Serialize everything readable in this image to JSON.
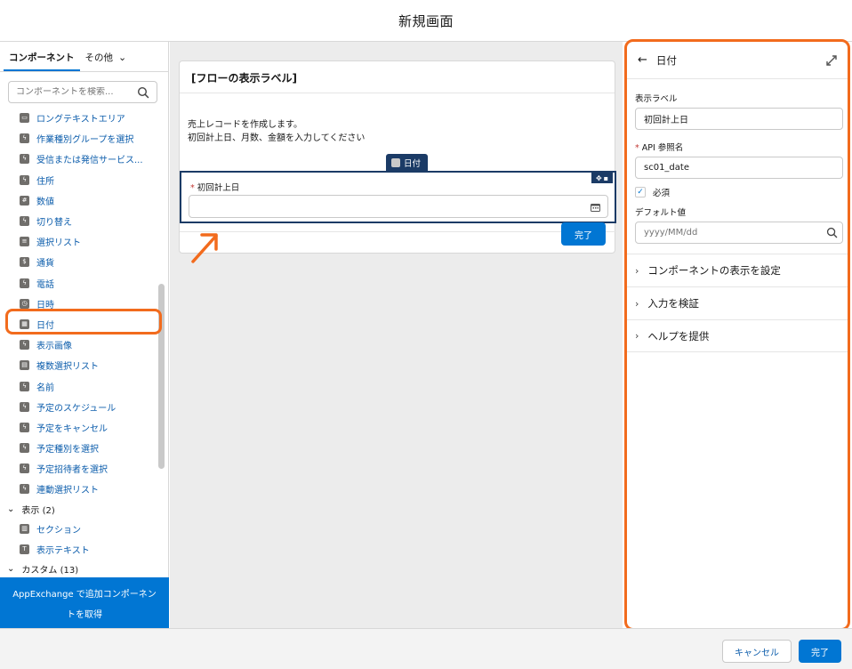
{
  "header": {
    "title": "新規画面"
  },
  "left_panel": {
    "tabs": [
      {
        "label": "コンポーネント"
      },
      {
        "label": "その他"
      }
    ],
    "search": {
      "placeholder": "コンポーネントを検索..."
    },
    "items": [
      {
        "label": "ロングテキストエリア",
        "icon": "textarea-icon"
      },
      {
        "label": "作業種別グループを選択",
        "icon": "lightning-icon"
      },
      {
        "label": "受信または発信サービス...",
        "icon": "lightning-icon"
      },
      {
        "label": "住所",
        "icon": "lightning-icon"
      },
      {
        "label": "数値",
        "icon": "number-icon"
      },
      {
        "label": "切り替え",
        "icon": "lightning-icon"
      },
      {
        "label": "選択リスト",
        "icon": "list-icon"
      },
      {
        "label": "通貨",
        "icon": "currency-icon"
      },
      {
        "label": "電話",
        "icon": "lightning-icon"
      },
      {
        "label": "日時",
        "icon": "clock-icon"
      },
      {
        "label": "日付",
        "icon": "calendar-icon"
      },
      {
        "label": "表示画像",
        "icon": "lightning-icon"
      },
      {
        "label": "複数選択リスト",
        "icon": "multiselect-icon"
      },
      {
        "label": "名前",
        "icon": "lightning-icon"
      },
      {
        "label": "予定のスケジュール",
        "icon": "lightning-icon"
      },
      {
        "label": "予定をキャンセル",
        "icon": "lightning-icon"
      },
      {
        "label": "予定種別を選択",
        "icon": "lightning-icon"
      },
      {
        "label": "予定招待者を選択",
        "icon": "lightning-icon"
      },
      {
        "label": "連動選択リスト",
        "icon": "lightning-icon"
      }
    ],
    "group_display": {
      "label": "表示 (2)"
    },
    "display_items": [
      {
        "label": "セクション",
        "icon": "section-icon"
      },
      {
        "label": "表示テキスト",
        "icon": "text-icon"
      }
    ],
    "group_custom": {
      "label": "カスタム (13)"
    },
    "appexchange": {
      "label": "AppExchange で追加コンポーネントを取得"
    }
  },
  "canvas": {
    "card_title": "[フローの表示ラベル]",
    "description_line1": "売上レコードを作成します。",
    "description_line2": "初回計上日、月数、金額を入力してください",
    "selected_tag": "日付",
    "field_label": "初回計上日",
    "done_label": "完了"
  },
  "right_panel": {
    "title": "日付",
    "label_caption": "表示ラベル",
    "label_value": "初回計上日",
    "api_caption": "API 参照名",
    "api_value": "sc01_date",
    "required_label": "必須",
    "default_caption": "デフォルト値",
    "default_placeholder": "yyyy/MM/dd",
    "sections": [
      {
        "label": "コンポーネントの表示を設定"
      },
      {
        "label": "入力を検証"
      },
      {
        "label": "ヘルプを提供"
      }
    ]
  },
  "footer": {
    "cancel_label": "キャンセル",
    "done_label": "完了"
  },
  "colors": {
    "brand": "#0176d3",
    "highlight": "#f26b1d",
    "selected": "#1b3b66"
  }
}
